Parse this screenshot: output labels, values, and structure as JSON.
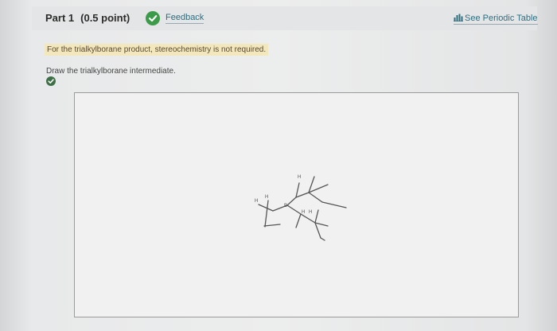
{
  "header": {
    "part_label": "Part 1",
    "points_label": "(0.5 point)",
    "feedback_label": "Feedback",
    "periodic_table_label": "See Periodic Table"
  },
  "question": {
    "note": "For the trialkylborane product, stereochemistry is not required.",
    "instruction": "Draw the trialkylborane intermediate."
  },
  "molecule": {
    "atom_labels": [
      "H",
      "H",
      "H",
      "B",
      "H",
      "H"
    ]
  },
  "colors": {
    "check_green": "#3b9b49",
    "link_color": "#2f6f80",
    "note_highlight": "#f3e7bd"
  },
  "icons": {
    "feedback": "check-circle-icon",
    "periodic_table": "bar-chart-icon",
    "status": "check-circle-icon"
  }
}
